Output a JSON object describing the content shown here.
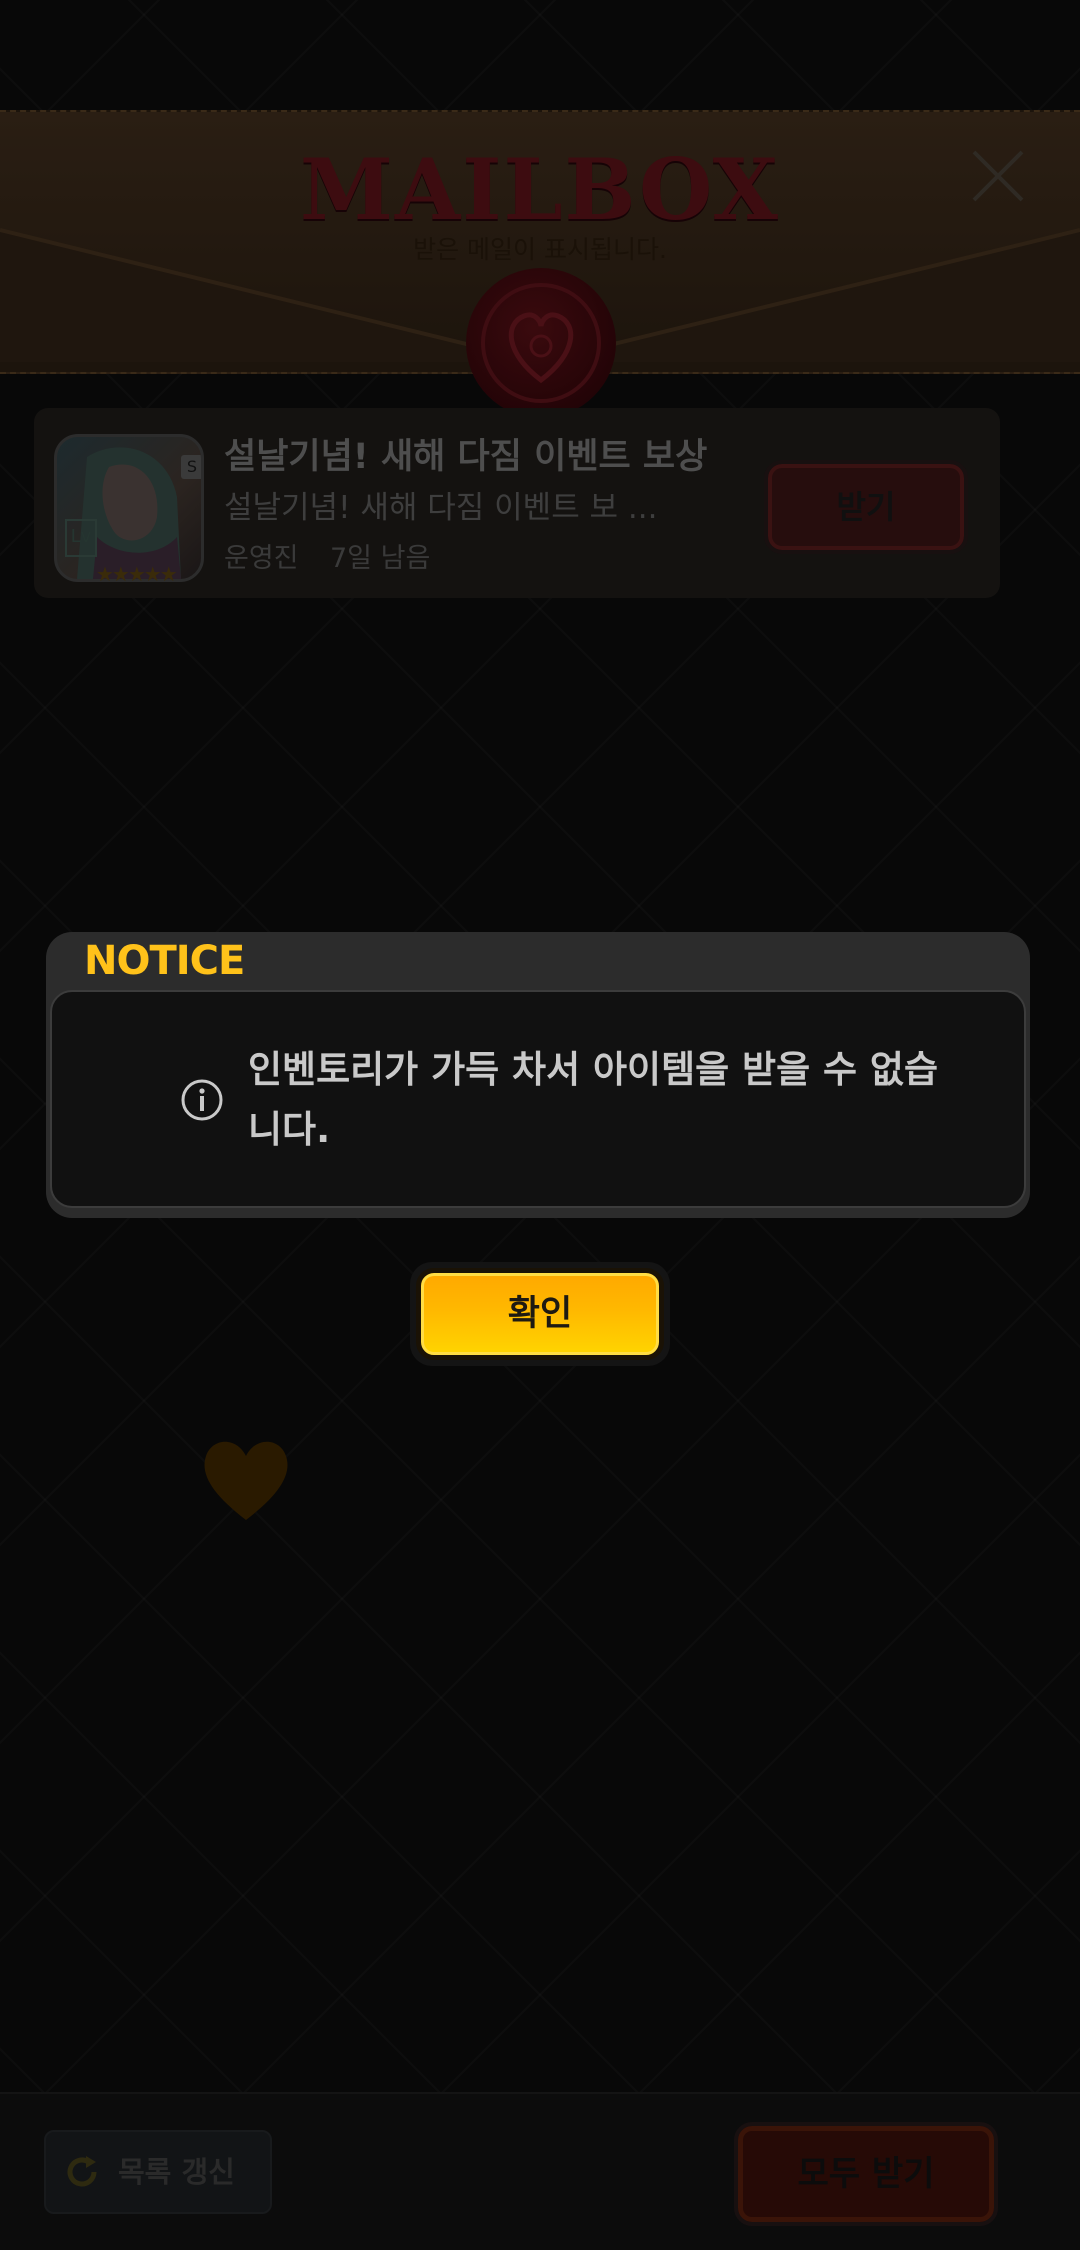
{
  "header": {
    "title": "MAILBOX",
    "subtitle": "받은 메일이 표시됩니다."
  },
  "mail_items": [
    {
      "title": "설날기념! 새해 다짐 이벤트 보상",
      "description": "설날기념! 새해 다짐 이벤트 보  ...",
      "sender": "운영진",
      "expires": "7일 남음",
      "receive_label": "받기",
      "badge": "S",
      "level_label": "Lv",
      "stars": "★★★★★"
    }
  ],
  "footer": {
    "refresh_label": "목록 갱신",
    "receive_all_label": "모두 받기"
  },
  "notice": {
    "title": "NOTICE",
    "message": "인벤토리가 가득 차서 아이템을 받을 수 없습니다.",
    "confirm_label": "확인"
  },
  "colors": {
    "notice_title": "#ffc21a",
    "confirm_button": "#ffb800",
    "overlay_background": "#080808"
  },
  "icons": {
    "close": "close-icon",
    "info": "info-icon",
    "refresh": "refresh-icon",
    "seal": "wax-seal-icon",
    "heart": "heart-icon"
  }
}
